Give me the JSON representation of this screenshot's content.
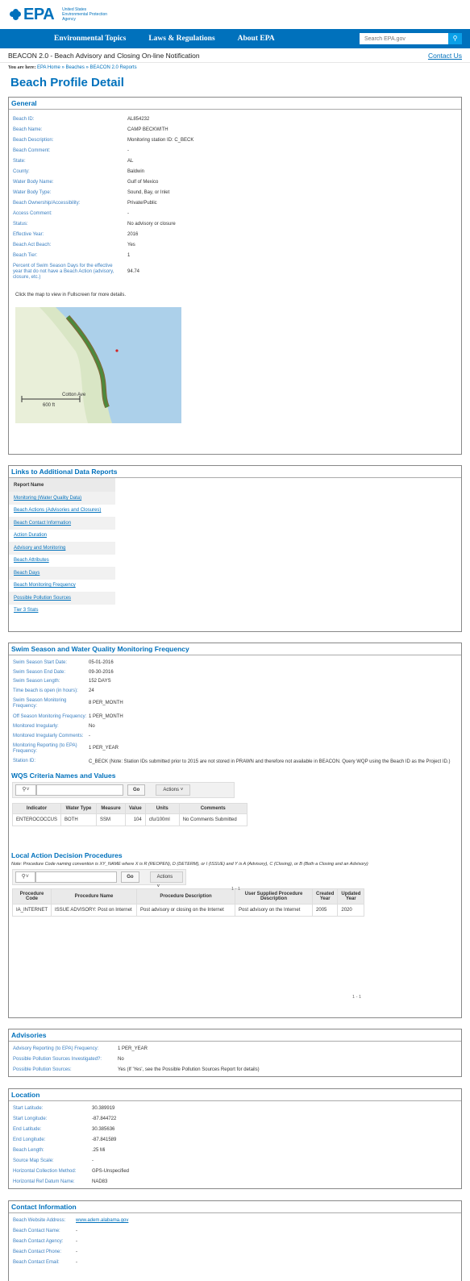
{
  "header": {
    "logo": "EPA",
    "agency_lines": [
      "United States",
      "Environmental Protection",
      "Agency"
    ],
    "nav": [
      "Environmental Topics",
      "Laws & Regulations",
      "About EPA"
    ],
    "search_placeholder": "Search EPA.gov",
    "search_icon": "search-icon"
  },
  "beacon": {
    "title": "BEACON 2.0 - Beach Advisory and Closing On-line Notification",
    "contact": "Contact Us"
  },
  "breadcrumb": {
    "label": "You are here:",
    "path": "EPA Home » Beaches » BEACON 2.0 Reports"
  },
  "page_title": "Beach Profile Detail",
  "general": {
    "heading": "General",
    "rows": [
      {
        "k": "Beach ID:",
        "v": "AL854232"
      },
      {
        "k": "Beach Name:",
        "v": "CAMP BECKWITH"
      },
      {
        "k": "Beach Description:",
        "v": "Monitoring station ID: C_BECK"
      },
      {
        "k": "Beach Comment:",
        "v": "-"
      },
      {
        "k": "State:",
        "v": "AL"
      },
      {
        "k": "County:",
        "v": "Baldwin"
      },
      {
        "k": "Water Body Name:",
        "v": "Gulf of Mexico"
      },
      {
        "k": "Water Body Type:",
        "v": "Sound, Bay, or Inlet"
      },
      {
        "k": "Beach Ownership/Accessibility:",
        "v": "Private/Public"
      },
      {
        "k": "Access Comment:",
        "v": "-"
      },
      {
        "k": "Status:",
        "v": "No advisory or closure"
      },
      {
        "k": "Effective Year:",
        "v": "2016"
      },
      {
        "k": "Beach Act Beach:",
        "v": "Yes"
      },
      {
        "k": "Beach Tier:",
        "v": "1"
      }
    ],
    "percent_label": "Percent of Swim Season Days for the effective year that do not have a Beach Action (advisory, closure, etc.)",
    "percent_value": "94.74",
    "map_note": "Click the map to view in Fullscreen for more details.",
    "map_road": "Cotton Ave",
    "map_scale": "600 ft"
  },
  "links": {
    "heading": "Links to Additional Data Reports",
    "column": "Report Name",
    "items": [
      "Monitoring (Water Quality Data)",
      "Beach Actions (Advisories and Closures)",
      "Beach Contact Information",
      "Action Duration",
      "Advisory and Monitoring",
      "Beach Attributes",
      "Beach Days",
      "Beach Monitoring Frequency",
      "Possible Pollution Sources",
      "Tier 3 Stats"
    ]
  },
  "swim": {
    "heading": "Swim Season and Water Quality Monitoring Frequency",
    "rows": [
      {
        "k": "Swim Season Start Date:",
        "v": "05-01-2016"
      },
      {
        "k": "Swim Season End Date:",
        "v": "09-30-2016"
      },
      {
        "k": "Swim Season Length:",
        "v": "152 DAYS"
      },
      {
        "k": "Time beach is open (in hours):",
        "v": "24"
      },
      {
        "k": "Swim Season Monitoring Frequency:",
        "v": "8 PER_MONTH"
      },
      {
        "k": "Off Season Monitoring Frequency:",
        "v": "1 PER_MONTH"
      },
      {
        "k": "Monitored Irregularly:",
        "v": "No"
      },
      {
        "k": "Monitored Irregularly Comments:",
        "v": "-"
      },
      {
        "k": "Monitoring Reporting (to EPA) Frequency:",
        "v": "1 PER_YEAR"
      },
      {
        "k": "Station ID:",
        "v": "C_BECK (Note: Station IDs submitted prior to 2015 are not stored in PRAWN and therefore not available in BEACON. Query WQP using the Beach ID as the Project ID.)"
      }
    ]
  },
  "wqs": {
    "heading": "WQS Criteria Names and Values",
    "go": "Go",
    "actions": "Actions",
    "columns": [
      "Indicator",
      "Water Type",
      "Measure",
      "Value",
      "Units",
      "Comments"
    ],
    "rows": [
      [
        "ENTEROCOCCUS",
        "BOTH",
        "SSM",
        "104",
        "cfu/100ml",
        "No Comments Submitted"
      ]
    ],
    "pager": "1 - 1"
  },
  "procedures": {
    "heading": "Local Action Decision Procedures",
    "note": "Note: Procedure Code naming convention is XY_NAME where X is R (REOPEN), D (DETERM), or I (ISSUE) and Y is A (Advisory), C (Closing), or B (Both a Closing and an Advisory)",
    "go": "Go",
    "actions": "Actions",
    "columns": [
      "Procedure Code",
      "Procedure Name",
      "Procedure Description",
      "User Supplied Procedure Description",
      "Created Year",
      "Updated Year"
    ],
    "rows": [
      [
        "IA_INTERNET",
        "ISSUE ADVISORY: Post on Internet",
        "Post advisory or closing on the Internet",
        "Post advisory on the Internet",
        "2005",
        "2020"
      ]
    ],
    "pager": "1 - 1"
  },
  "advisories": {
    "heading": "Advisories",
    "rows": [
      {
        "k": "Advisory Reporting (to EPA) Frequency:",
        "v": "1 PER_YEAR"
      },
      {
        "k": "Possible Pollution Sources Investigated?:",
        "v": "No"
      },
      {
        "k": "Possible Pollution Sources:",
        "v": "Yes (If 'Yes', see the Possible Pollution Sources Report for details)"
      }
    ]
  },
  "location": {
    "heading": "Location",
    "rows": [
      {
        "k": "Start Latitude:",
        "v": "30.389919"
      },
      {
        "k": "Start Longitude:",
        "v": "-87.844722"
      },
      {
        "k": "End Latitude:",
        "v": "30.385636"
      },
      {
        "k": "End Longitude:",
        "v": "-87.841589"
      },
      {
        "k": "Beach Length:",
        "v": ".25 Mi"
      },
      {
        "k": "Source Map Scale:",
        "v": "-"
      },
      {
        "k": "Horizontal Collection Method:",
        "v": "GPS-Unspecified"
      },
      {
        "k": "Horizontal Ref Datum Name:",
        "v": "NAD83"
      }
    ]
  },
  "contact": {
    "heading": "Contact Information",
    "rows": [
      {
        "k": "Beach Website Address:",
        "v": "www.adem.alabama.gov"
      },
      {
        "k": "Beach Contact Name:",
        "v": "-"
      },
      {
        "k": "Beach Contact Agency:",
        "v": "-"
      },
      {
        "k": "Beach Contact Phone:",
        "v": "-"
      },
      {
        "k": "Beach Contact Email:",
        "v": "-"
      }
    ]
  },
  "colors": {
    "primary": "#0071bc",
    "label": "#3a7fc1",
    "shoreline": "#4c8a3c",
    "water": "#acd0ea"
  }
}
